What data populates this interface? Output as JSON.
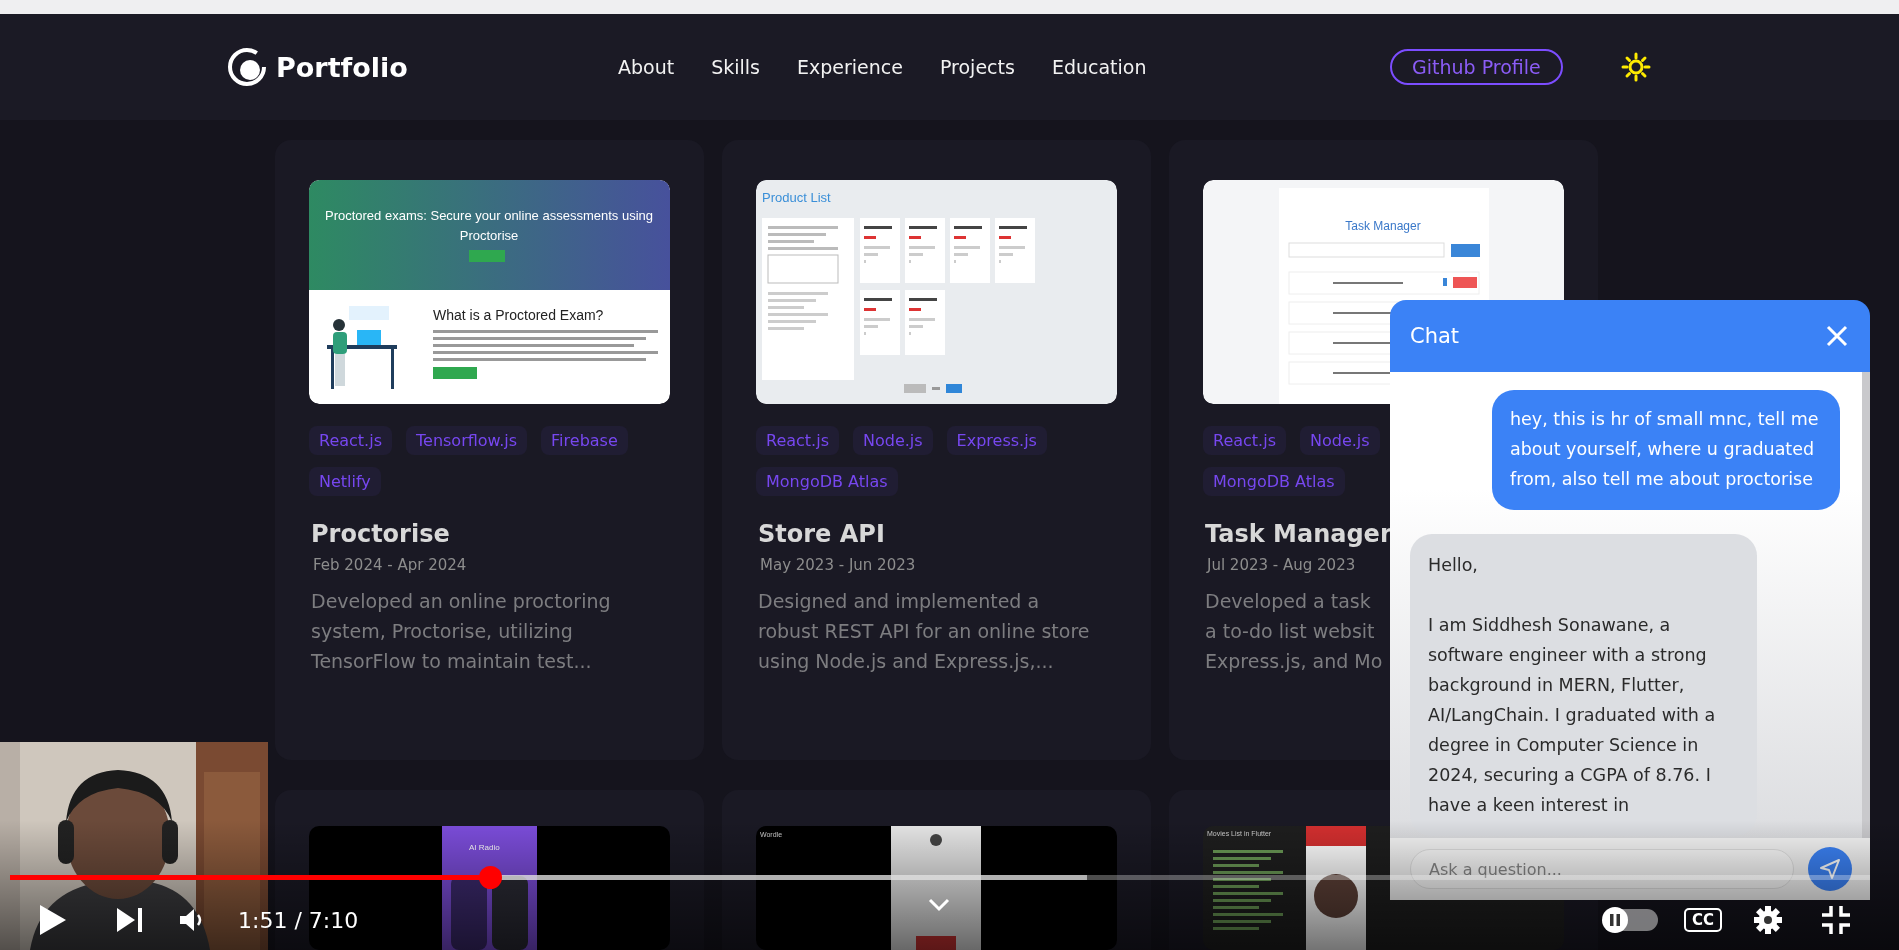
{
  "nav": {
    "logo": "Portfolio",
    "links": [
      {
        "label": "About"
      },
      {
        "label": "Skills"
      },
      {
        "label": "Experience"
      },
      {
        "label": "Projects"
      },
      {
        "label": "Education"
      }
    ],
    "github_button": "Github Profile"
  },
  "projects": [
    {
      "preview": {
        "kind": "proctor",
        "heading": "Proctored exams: Secure your online assessments using Proctorise",
        "subheading": "What is a Proctored Exam?"
      },
      "tags": [
        "React.js",
        "Tensorflow.js",
        "Firebase",
        "Netlify"
      ],
      "title": "Proctorise",
      "dates": "Feb 2024 - Apr 2024",
      "description_lines": [
        "Developed an online proctoring",
        "system, Proctorise, utilizing",
        "TensorFlow to maintain test..."
      ]
    },
    {
      "preview": {
        "kind": "store",
        "heading": "Product List"
      },
      "tags": [
        "React.js",
        "Node.js",
        "Express.js",
        "MongoDB Atlas"
      ],
      "title": "Store API",
      "dates": "May 2023 - Jun 2023",
      "description_lines": [
        "Designed and implemented a",
        "robust REST API for an online store",
        "using Node.js and Express.js,..."
      ]
    },
    {
      "preview": {
        "kind": "tasks",
        "heading": "Task Manager"
      },
      "tags": [
        "React.js",
        "Node.js",
        "MongoDB Atlas"
      ],
      "title": "Task Manager",
      "dates": "Jul 2023 - Aug 2023",
      "description_lines": [
        "Developed a task",
        "a to-do list websit",
        "Express.js, and Mo"
      ]
    },
    {
      "preview": {
        "kind": "phone",
        "heading": "AI Radio"
      }
    },
    {
      "preview": {
        "kind": "game",
        "heading": "Wordle"
      }
    },
    {
      "preview": {
        "kind": "code",
        "heading": "Movies List in Flutter"
      }
    }
  ],
  "chat": {
    "title": "Chat",
    "messages": [
      {
        "kind": "user",
        "text": "hey, this is hr of small mnc, tell me about yourself, where u graduated from, also tell me about proctorise"
      },
      {
        "kind": "bot",
        "text": "Hello,\n\nI am Siddhesh Sonawane, a software engineer with a strong background in MERN, Flutter, AI/LangChain. I graduated with a degree in Computer Science in 2024, securing a CGPA of 8.76. I have a keen interest in"
      }
    ],
    "input": {
      "placeholder": "Ask a question..."
    }
  },
  "player": {
    "progress": {
      "level": 0.258
    },
    "buffered": {
      "level": 0.579
    },
    "time": "1:51 / 7:10",
    "autoplay": {
      "on": false
    },
    "captions": {
      "label": "CC",
      "on": false
    }
  }
}
